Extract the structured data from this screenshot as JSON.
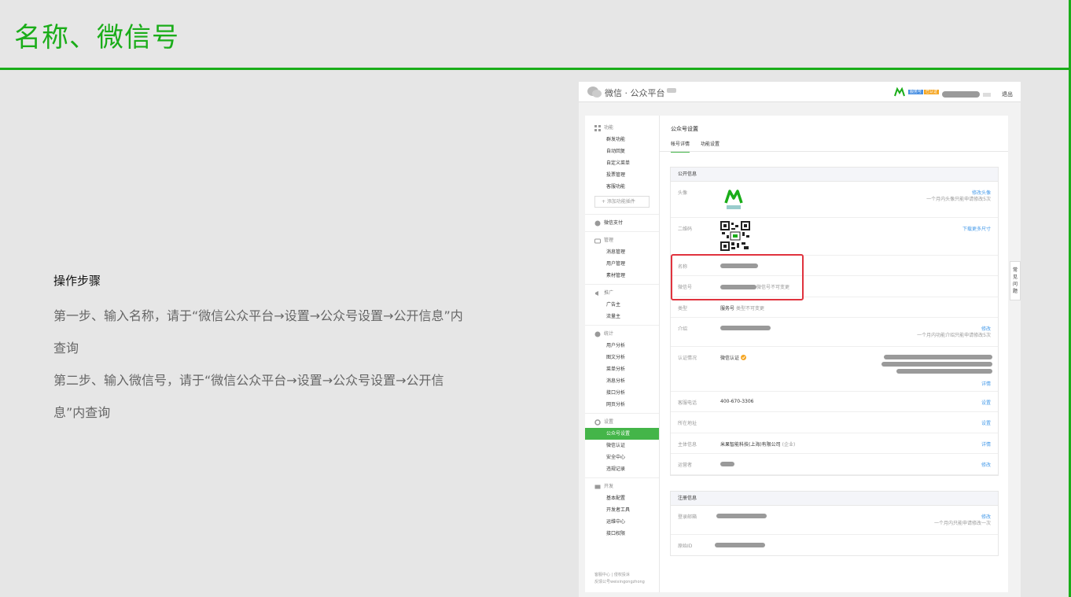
{
  "slide": {
    "title": "名称、微信号",
    "steps_heading": "操作步骤",
    "step1": "第一步、输入名称，请于“微信公众平台→设置→公众号设置→公开信息”内查询",
    "step2": "第二步、输入微信号，请于“微信公众平台→设置→公众号设置→公开信息”内查询"
  },
  "colors": {
    "accent": "#1aad19",
    "sidebar_active": "#44b549",
    "link": "#459ae9",
    "highlight": "#e0333e"
  },
  "platform": {
    "name": "微信 · 公众平台",
    "logout": "退出",
    "badge_type": "服务号",
    "badge_verified": "已认证"
  },
  "sidebar": {
    "groups": [
      {
        "label": "功能",
        "icon": "grid-icon",
        "items": [
          "群发功能",
          "自动回复",
          "自定义菜单",
          "投票管理",
          "客服功能"
        ]
      },
      {
        "label": "微信支付",
        "icon": "pay-icon",
        "items": []
      },
      {
        "label": "管理",
        "icon": "manage-icon",
        "items": [
          "消息管理",
          "用户管理",
          "素材管理"
        ]
      },
      {
        "label": "推广",
        "icon": "promote-icon",
        "items": [
          "广告主",
          "流量主"
        ]
      },
      {
        "label": "统计",
        "icon": "stats-icon",
        "items": [
          "用户分析",
          "图文分析",
          "菜单分析",
          "消息分析",
          "接口分析",
          "网页分析"
        ]
      },
      {
        "label": "设置",
        "icon": "settings-icon",
        "items": [
          "公众号设置",
          "微信认证",
          "安全中心",
          "违规记录"
        ]
      },
      {
        "label": "开发",
        "icon": "dev-icon",
        "items": [
          "基本配置",
          "开发者工具",
          "运维中心",
          "接口权限"
        ]
      }
    ],
    "add_plugin": "+ 添加功能插件",
    "active_item": "公众号设置",
    "footer_line1": "客服中心 | 侵权投诉",
    "footer_line2": "反馈公号weixingongzhong"
  },
  "main": {
    "title": "公众号设置",
    "tabs": [
      "帐号详情",
      "功能设置"
    ],
    "public_info": {
      "header": "公开信息",
      "avatar_label": "头像",
      "avatar_link": "修改头像",
      "avatar_note": "一个月内头像只能申请修改5次",
      "qrcode_label": "二维码",
      "qrcode_link": "下载更多尺寸",
      "name_label": "名称",
      "wxid_label": "微信号",
      "wxid_hint": "微信号不可变更",
      "type_label": "类型",
      "type_value": "服务号",
      "type_hint": "类型不可变更",
      "intro_label": "介绍",
      "intro_link": "修改",
      "intro_note": "一个月内功能介绍只能申请修改5次",
      "verify_label": "认证情况",
      "verify_value": "微信认证",
      "verify_link": "详情",
      "phone_label": "客服电话",
      "phone_value": "400-670-3306",
      "phone_link": "设置",
      "address_label": "所在地址",
      "address_link": "设置",
      "entity_label": "主体信息",
      "entity_value": "米果智能科技(上海)有限公司",
      "entity_hint": "(企业)",
      "entity_link": "详情",
      "operator_label": "运营者",
      "operator_link": "修改"
    },
    "reg_info": {
      "header": "注册信息",
      "email_label": "登录邮箱",
      "email_link": "修改",
      "email_note": "一个月内只能申请修改一次",
      "origid_label": "原始ID"
    }
  },
  "help_tab": "常见问题"
}
